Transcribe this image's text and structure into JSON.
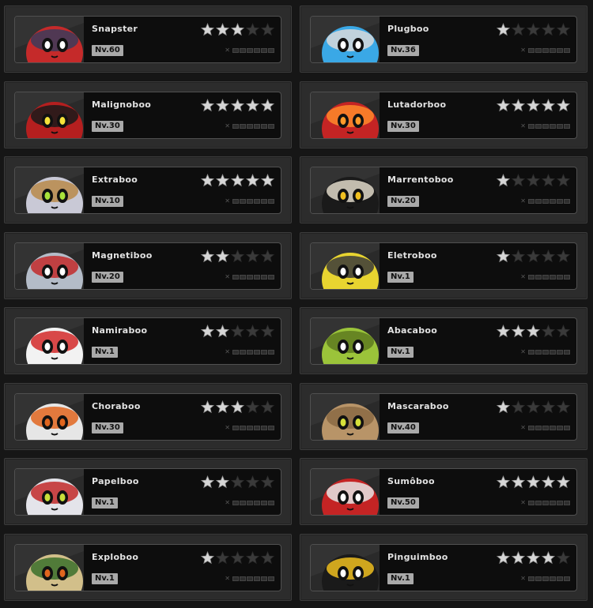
{
  "characters": [
    {
      "name": "Snapster",
      "level": "Nv.60",
      "stars": 3,
      "colors": {
        "body": "#c52a2a",
        "accent": "#3b3b5a",
        "eye": "#ffffff"
      }
    },
    {
      "name": "Plugboo",
      "level": "Nv.36",
      "stars": 1,
      "colors": {
        "body": "#3aa8e6",
        "accent": "#d9d9d9",
        "eye": "#ffffff"
      }
    },
    {
      "name": "Malignoboo",
      "level": "Nv.30",
      "stars": 5,
      "colors": {
        "body": "#b51f1f",
        "accent": "#1a1a1a",
        "eye": "#f5e23a"
      }
    },
    {
      "name": "Lutadorboo",
      "level": "Nv.30",
      "stars": 5,
      "colors": {
        "body": "#c42424",
        "accent": "#ff8a2a",
        "eye": "#ff9a2a"
      }
    },
    {
      "name": "Extraboo",
      "level": "Nv.10",
      "stars": 5,
      "colors": {
        "body": "#c9c9d6",
        "accent": "#b8894a",
        "eye": "#a8e23a"
      }
    },
    {
      "name": "Marrentoboo",
      "level": "Nv.20",
      "stars": 1,
      "colors": {
        "body": "#1a1a1a",
        "accent": "#e0d9c9",
        "eye": "#f0c020"
      }
    },
    {
      "name": "Magnetiboo",
      "level": "Nv.20",
      "stars": 2,
      "colors": {
        "body": "#b4bcc8",
        "accent": "#c22a2a",
        "eye": "#ffffff"
      }
    },
    {
      "name": "Eletroboo",
      "level": "Nv.1",
      "stars": 1,
      "colors": {
        "body": "#e8d430",
        "accent": "#3a3a3a",
        "eye": "#ffffff"
      }
    },
    {
      "name": "Namiraboo",
      "level": "Nv.1",
      "stars": 2,
      "colors": {
        "body": "#f2f2f2",
        "accent": "#d42a2a",
        "eye": "#ffffff"
      }
    },
    {
      "name": "Abacaboo",
      "level": "Nv.1",
      "stars": 3,
      "colors": {
        "body": "#9bc43a",
        "accent": "#5e7a20",
        "eye": "#ffffff"
      }
    },
    {
      "name": "Choraboo",
      "level": "Nv.30",
      "stars": 3,
      "colors": {
        "body": "#e6e6e6",
        "accent": "#e0651e",
        "eye": "#e0651e"
      }
    },
    {
      "name": "Mascaraboo",
      "level": "Nv.40",
      "stars": 1,
      "colors": {
        "body": "#b89468",
        "accent": "#8a6a44",
        "eye": "#d6e03a"
      }
    },
    {
      "name": "Papelboo",
      "level": "Nv.1",
      "stars": 2,
      "colors": {
        "body": "#e4e4ea",
        "accent": "#c22a2a",
        "eye": "#c8e03a"
      }
    },
    {
      "name": "Sumôboo",
      "level": "Nv.50",
      "stars": 5,
      "colors": {
        "body": "#c42424",
        "accent": "#e6e6e6",
        "eye": "#ffffff"
      }
    },
    {
      "name": "Exploboo",
      "level": "Nv.1",
      "stars": 1,
      "colors": {
        "body": "#d2bf8a",
        "accent": "#3b6e2a",
        "eye": "#e0651e"
      }
    },
    {
      "name": "Pinguimboo",
      "level": "Nv.1",
      "stars": 4,
      "colors": {
        "body": "#1a1a1a",
        "accent": "#f0c020",
        "eye": "#ffffff"
      }
    }
  ],
  "max_stars": 5,
  "star_colors": {
    "filled": "#d6d6d6",
    "empty": "#3a3a3a"
  },
  "icons": {
    "star": "star-icon",
    "lock": "lock-icon"
  }
}
